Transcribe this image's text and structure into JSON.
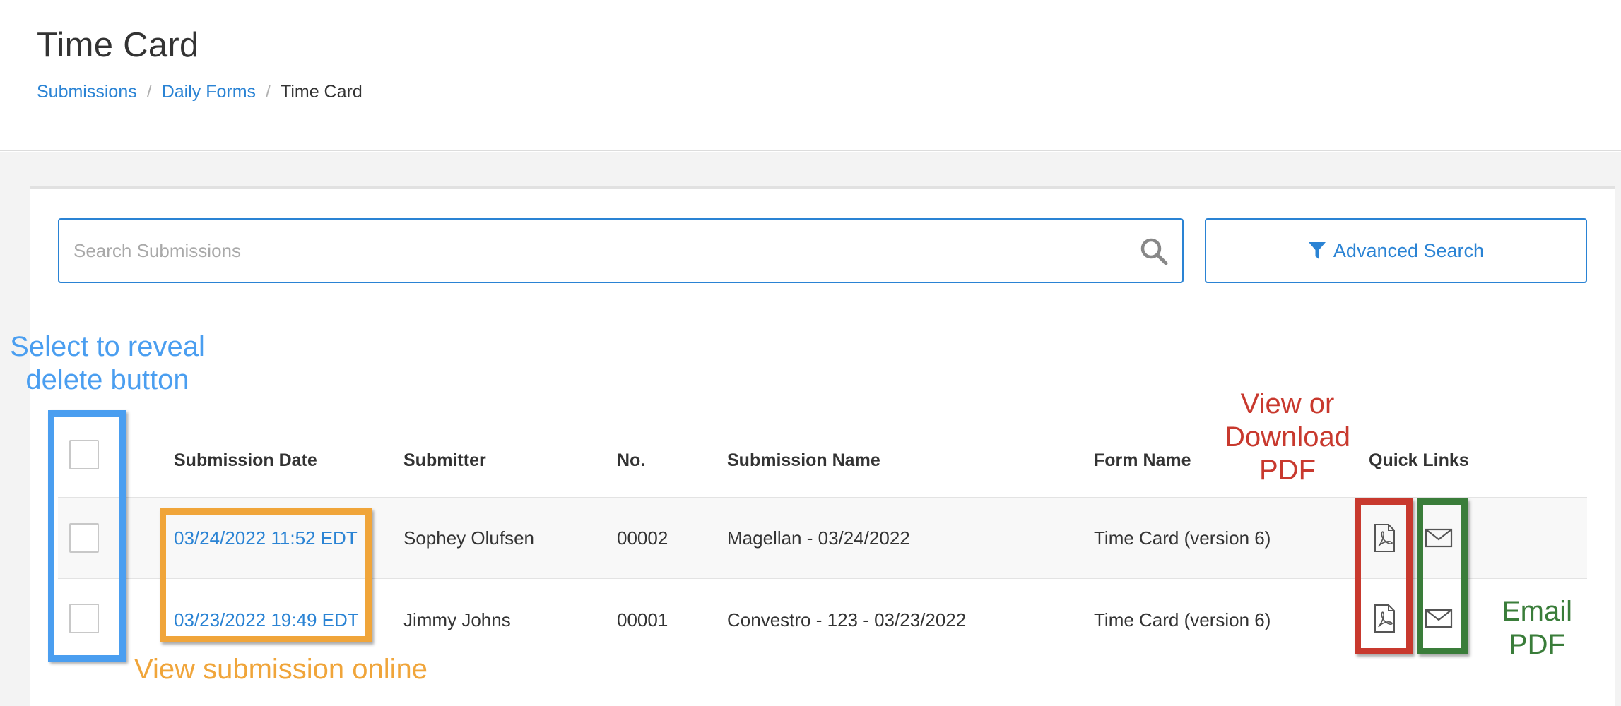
{
  "header": {
    "title": "Time Card",
    "breadcrumb": [
      {
        "label": "Submissions"
      },
      {
        "label": "Daily Forms"
      },
      {
        "label": "Time Card"
      }
    ],
    "separator": "/"
  },
  "search": {
    "placeholder": "Search Submissions",
    "value": "",
    "advanced_label": "Advanced Search"
  },
  "table": {
    "columns": [
      "Submission Date",
      "Submitter",
      "No.",
      "Submission Name",
      "Form Name",
      "Quick Links"
    ],
    "rows": [
      {
        "date": "03/24/2022 11:52 EDT",
        "submitter": "Sophey Olufsen",
        "no": "00002",
        "name": "Magellan - 03/24/2022",
        "form": "Time Card (version 6)"
      },
      {
        "date": "03/23/2022 19:49 EDT",
        "submitter": "Jimmy Johns",
        "no": "00001",
        "name": "Convestro - 123 - 03/23/2022",
        "form": "Time Card (version 6)"
      }
    ]
  },
  "annotations": {
    "select": {
      "line1": "Select to reveal",
      "line2": "delete button",
      "color": "#4a9ef0"
    },
    "view_online": {
      "text": "View submission online",
      "color": "#f0a53a"
    },
    "pdf": {
      "line1": "View or",
      "line2": "Download",
      "line3": "PDF",
      "color": "#c8392e"
    },
    "email": {
      "line1": "Email",
      "line2": "PDF",
      "color": "#3a7d3a"
    }
  },
  "icons": {
    "search": "search-icon",
    "filter": "funnel-icon",
    "pdf": "pdf-icon",
    "email": "envelope-icon"
  },
  "colors": {
    "accent": "#2a83d4",
    "panel_bg": "#f3f3f3"
  }
}
